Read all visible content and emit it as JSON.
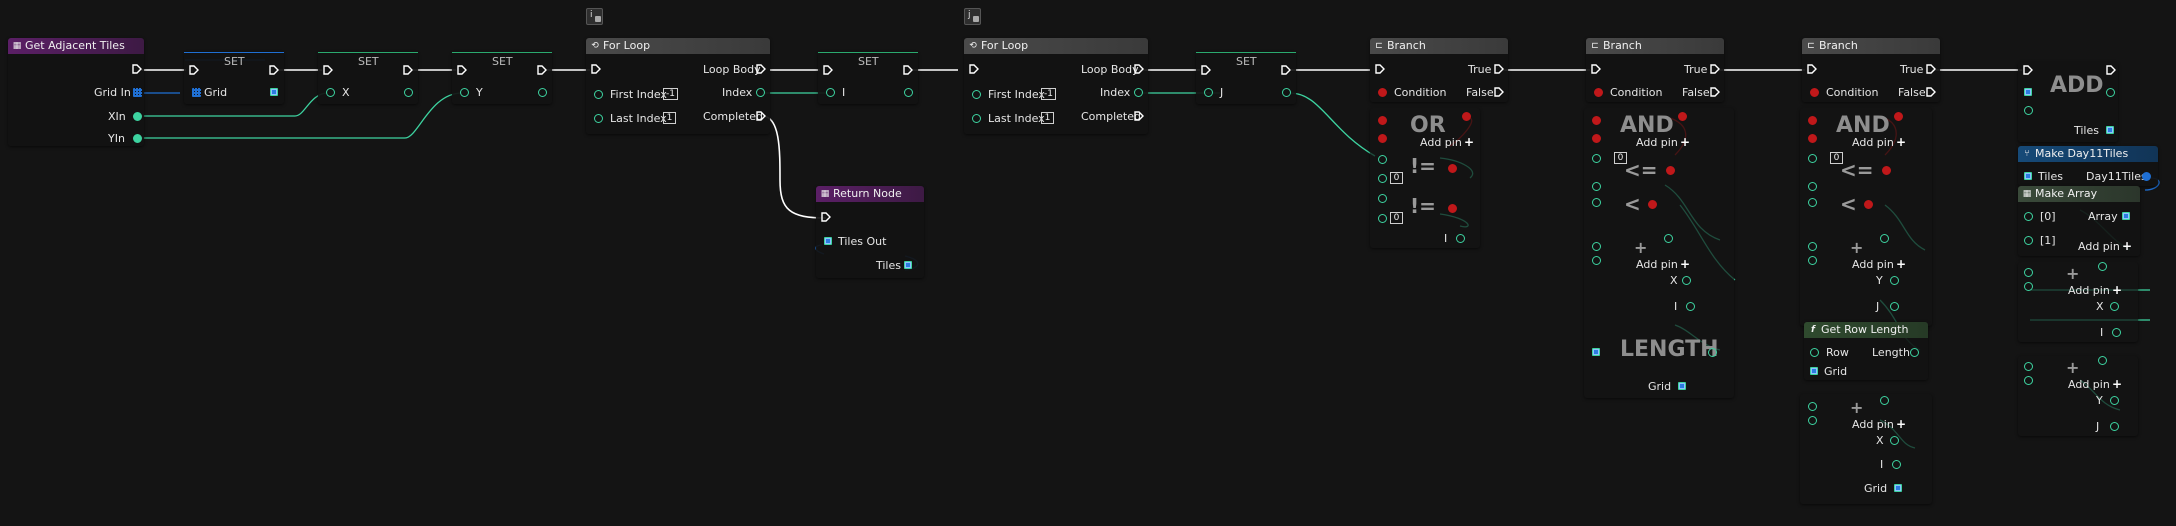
{
  "colors": {
    "exec": "#ffffff",
    "int": "#3dd3a0",
    "bool": "#c0181a",
    "array": "#1f6fd3",
    "function_header": "#5b1f66",
    "branch_header": "#4a4a4a",
    "make_struct_header": "#164a78",
    "pure_function_header": "#2f4a2e"
  },
  "function_entry": {
    "title": "Get Adjacent Tiles",
    "pins": [
      "Grid In",
      "XIn",
      "YIn"
    ]
  },
  "sets": {
    "title": "SET",
    "grid": "Grid",
    "x": "X",
    "y": "Y",
    "i": "I",
    "j": "J"
  },
  "loop_i": {
    "title": "For Loop",
    "badge": "i",
    "first_index": "First Index",
    "first_value": "-1",
    "last_index": "Last Index",
    "last_value": "1",
    "loop_body": "Loop Body",
    "index": "Index",
    "completed": "Completed"
  },
  "loop_j": {
    "title": "For Loop",
    "badge": "j",
    "first_index": "First Index",
    "first_value": "-1",
    "last_index": "Last Index",
    "last_value": "1",
    "loop_body": "Loop Body",
    "index": "Index",
    "completed": "Completed"
  },
  "return_node": {
    "title": "Return Node",
    "tiles_out": "Tiles Out",
    "tiles": "Tiles"
  },
  "branches": [
    {
      "title": "Branch",
      "condition": "Condition",
      "true": "True",
      "false": "False"
    },
    {
      "title": "Branch",
      "condition": "Condition",
      "true": "True",
      "false": "False"
    },
    {
      "title": "Branch",
      "condition": "Condition",
      "true": "True",
      "false": "False"
    }
  ],
  "ops": {
    "or": "OR",
    "and": "AND",
    "add_pin": "Add pin",
    "neq": "!=",
    "lt": "<=",
    "less": "<",
    "plus": "+",
    "length": "LENGTH",
    "add": "ADD",
    "zero": "0"
  },
  "vars": {
    "i": "I",
    "x": "X",
    "y": "Y",
    "j": "J",
    "grid": "Grid",
    "tiles": "Tiles"
  },
  "get_row_length": {
    "title": "Get Row Length",
    "row": "Row",
    "length": "Length",
    "grid": "Grid"
  },
  "make_struct": {
    "title": "Make Day11Tiles",
    "tiles": "Tiles",
    "output": "Day11Tiles"
  },
  "make_array": {
    "title": "Make Array",
    "idx0": "[0]",
    "idx1": "[1]",
    "array": "Array",
    "add_pin": "Add pin"
  }
}
